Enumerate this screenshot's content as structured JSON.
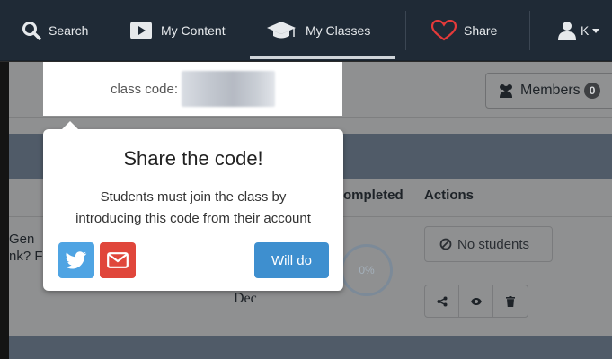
{
  "nav": {
    "search_label": "Search",
    "content_label": "My Content",
    "classes_label": "My Classes",
    "share_label": "Share",
    "user_initial": "K"
  },
  "toolbar": {
    "members_label": "Members",
    "members_count": "0"
  },
  "class_code": {
    "label": "class code:"
  },
  "popover": {
    "title": "Share the code!",
    "line1": "Students must join the class by",
    "line2": "introducing this code from their account",
    "will_do_label": "Will do"
  },
  "table": {
    "col_completed": "ompleted",
    "col_actions": "Actions",
    "row_fragment_1": "Gen",
    "row_fragment_2": "nk? F",
    "due_fragment": "Dec",
    "progress": "0%",
    "no_students_label": "No students"
  },
  "colors": {
    "nav_bg": "#1f2a36",
    "twitter": "#4fa4e3",
    "email": "#e0463b",
    "primary": "#3e8fcf",
    "heart": "#e53a3a"
  },
  "icons": [
    "search-icon",
    "play-icon",
    "graduation-cap-icon",
    "heart-icon",
    "user-icon",
    "users-icon",
    "ban-icon",
    "share-icon",
    "eye-icon",
    "trash-icon",
    "twitter-icon",
    "envelope-icon"
  ]
}
